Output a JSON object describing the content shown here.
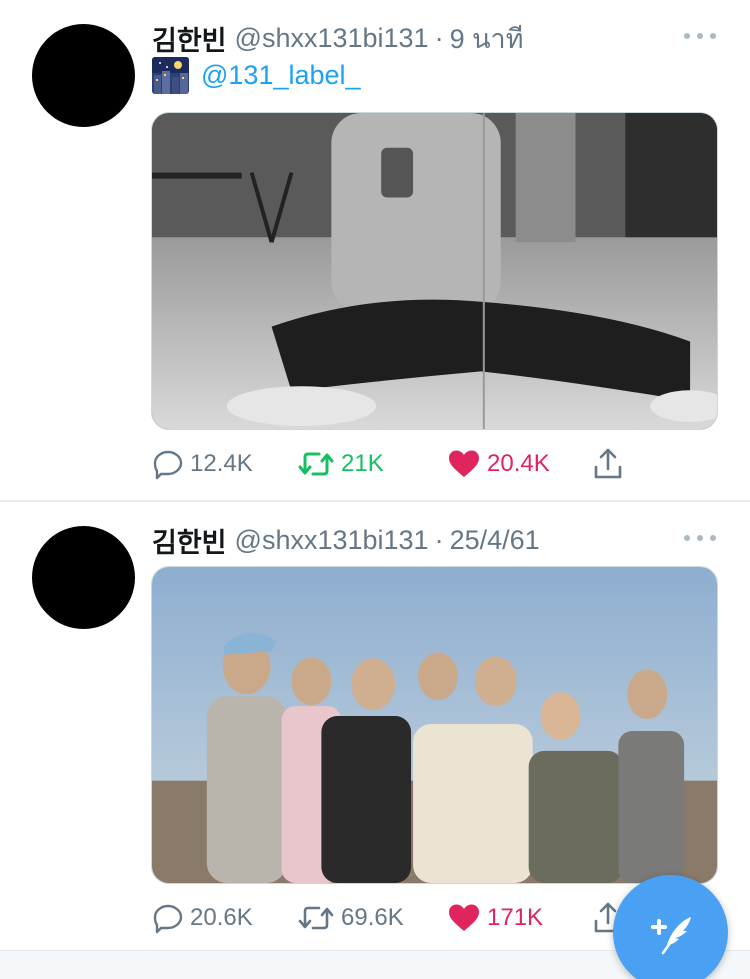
{
  "tweets": [
    {
      "name": "김한빈",
      "handle": "@shxx131bi131",
      "separator": "·",
      "time": "9 นาที",
      "mention": "@131_label_",
      "replies": "12.4K",
      "retweets": "21K",
      "likes": "20.4K"
    },
    {
      "name": "김한빈",
      "handle": "@shxx131bi131",
      "separator": "·",
      "time": "25/4/61",
      "replies": "20.6K",
      "retweets": "69.6K",
      "likes": "171K"
    }
  ],
  "icons": {
    "reply": "speech-bubble-icon",
    "retweet": "retweet-icon",
    "like": "heart-icon",
    "share": "share-icon",
    "more": "more-dots-icon",
    "compose": "compose-feather-icon"
  },
  "colors": {
    "accent": "#1da1f2",
    "retweet": "#17bf63",
    "like": "#e0245e",
    "secondary_text": "#657786",
    "fab": "#4aa1f3"
  }
}
